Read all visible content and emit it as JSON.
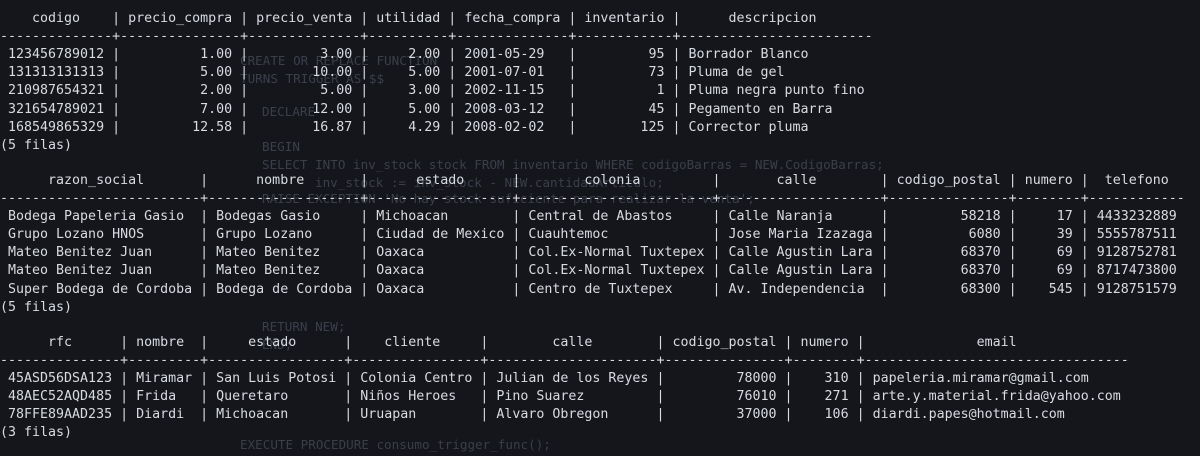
{
  "window": {
    "background_color": "#14161c",
    "text_color": "#d8dbe0"
  },
  "tables": [
    {
      "columns": [
        {
          "name": "codigo",
          "align": "left"
        },
        {
          "name": "precio_compra",
          "align": "right"
        },
        {
          "name": "precio_venta",
          "align": "right"
        },
        {
          "name": "utilidad",
          "align": "right"
        },
        {
          "name": "fecha_compra",
          "align": "left"
        },
        {
          "name": "inventario",
          "align": "right"
        },
        {
          "name": "descripcion",
          "align": "left"
        }
      ],
      "rows": [
        [
          "123456789012",
          "1.00",
          "3.00",
          "2.00",
          "2001-05-29",
          "95",
          "Borrador Blanco"
        ],
        [
          "131313131313",
          "5.00",
          "10.00",
          "5.00",
          "2001-07-01",
          "73",
          "Pluma de gel"
        ],
        [
          "210987654321",
          "2.00",
          "5.00",
          "3.00",
          "2002-11-15",
          "1",
          "Pluma negra punto fino"
        ],
        [
          "321654789021",
          "7.00",
          "12.00",
          "5.00",
          "2008-03-12",
          "45",
          "Pegamento en Barra"
        ],
        [
          "168549865329",
          "12.58",
          "16.87",
          "4.29",
          "2008-02-02",
          "125",
          "Corrector pluma"
        ]
      ],
      "footer": "(5 filas)"
    },
    {
      "columns": [
        {
          "name": "razon_social",
          "align": "left"
        },
        {
          "name": "nombre",
          "align": "left"
        },
        {
          "name": "estado",
          "align": "left"
        },
        {
          "name": "colonia",
          "align": "left"
        },
        {
          "name": "calle",
          "align": "left"
        },
        {
          "name": "codigo_postal",
          "align": "right"
        },
        {
          "name": "numero",
          "align": "right"
        },
        {
          "name": "telefono",
          "align": "left"
        }
      ],
      "rows": [
        [
          "Bodega Papeleria Gasio",
          "Bodegas Gasio",
          "Michoacan",
          "Central de Abastos",
          "Calle Naranja",
          "58218",
          "17",
          "4433232889"
        ],
        [
          "Grupo Lozano HNOS",
          "Grupo Lozano",
          "Ciudad de Mexico",
          "Cuauhtemoc",
          "Jose Maria Izazaga",
          "6080",
          "39",
          "5555787511"
        ],
        [
          "Mateo Benitez Juan",
          "Mateo Benitez",
          "Oaxaca",
          "Col.Ex-Normal Tuxtepex",
          "Calle Agustin Lara",
          "68370",
          "69",
          "9128752781"
        ],
        [
          "Mateo Benitez Juan",
          "Mateo Benitez",
          "Oaxaca",
          "Col.Ex-Normal Tuxtepex",
          "Calle Agustin Lara",
          "68370",
          "69",
          "8717473800"
        ],
        [
          "Super Bodega de Cordoba",
          "Bodega de Cordoba",
          "Oaxaca",
          "Centro de Tuxtepex",
          "Av. Independencia",
          "68300",
          "545",
          "9128751579"
        ]
      ],
      "footer": "(5 filas)"
    },
    {
      "columns": [
        {
          "name": "rfc",
          "align": "left"
        },
        {
          "name": "nombre",
          "align": "left"
        },
        {
          "name": "estado",
          "align": "left"
        },
        {
          "name": "cliente",
          "align": "left"
        },
        {
          "name": "calle",
          "align": "left"
        },
        {
          "name": "codigo_postal",
          "align": "right"
        },
        {
          "name": "numero",
          "align": "right"
        },
        {
          "name": "email",
          "align": "left"
        }
      ],
      "rows": [
        [
          "45ASD56DSA123",
          "Miramar",
          "San Luis Potosi",
          "Colonia Centro",
          "Julian de los Reyes",
          "78000",
          "310",
          "papeleria.miramar@gmail.com"
        ],
        [
          "48AEC52AQD485",
          "Frida",
          "Queretaro",
          "Niños Heroes",
          "Pino Suarez",
          "76010",
          "271",
          "arte.y.material.frida@yahoo.com"
        ],
        [
          "78FFE89AAD235",
          "Diardi",
          "Michoacan",
          "Uruapan",
          "Alvaro Obregon",
          "37000",
          "106",
          "diardi.papes@hotmail.com"
        ]
      ],
      "footer": "(3 filas)"
    }
  ],
  "background_code": [
    "CREATE OR REPLACE FUNCTION",
    "TURNS TRIGGER AS $$",
    "DECLARE",
    "BEGIN",
    "SELECT INTO inv_stock stock FROM inventario WHERE codigoBarras = NEW.CodigoBarras;",
    "inv_stock := inv_stock - NEW.cantidadArticulo;",
    "RAISE EXCEPTION 'No hay stock suficiente para realizar la venta';",
    "RETURN NEW;",
    "END;",
    "EXECUTE PROCEDURE consumo_trigger_func();"
  ]
}
